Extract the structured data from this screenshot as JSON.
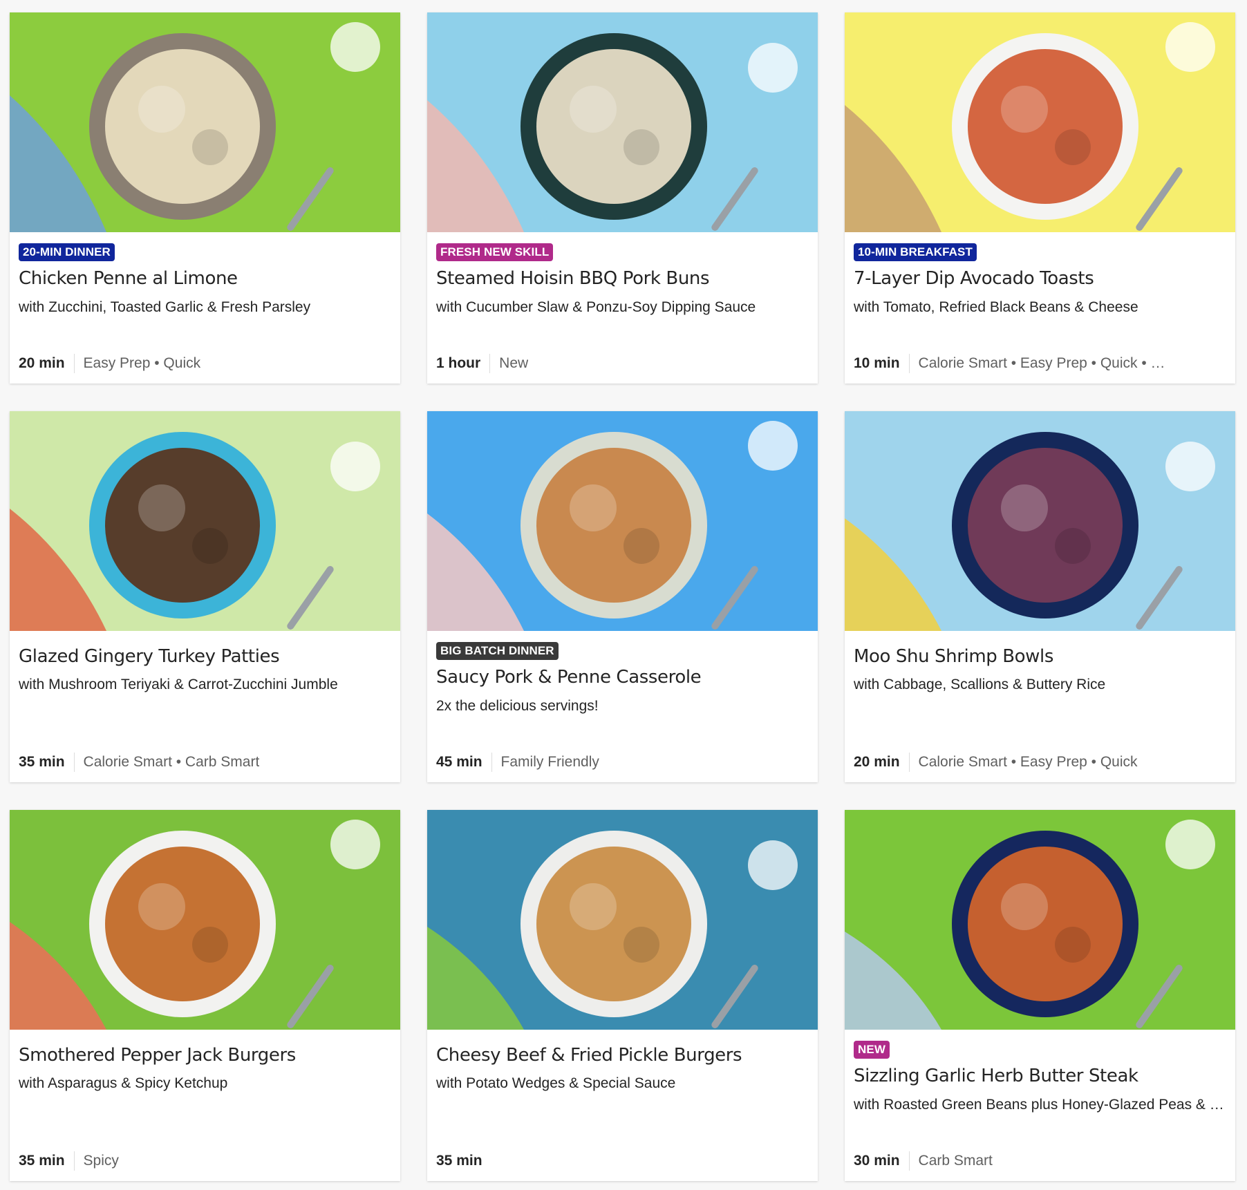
{
  "colors": {
    "badge_blue": "#10269c",
    "badge_magenta": "#b02a8a",
    "badge_dark": "#3a3a3a"
  },
  "recipes": [
    {
      "badge": "20-MIN DINNER",
      "badge_color": "#10269c",
      "title": "Chicken Penne al Limone",
      "subtitle": "with Zucchini, Toasted Garlic & Fresh Parsley",
      "time": "20 min",
      "tags": "Easy Prep • Quick",
      "bg": "#8ccc3e",
      "plate": "#8a7f72",
      "food": "#ece2c2",
      "accent": "#6ea0d8"
    },
    {
      "badge": "FRESH NEW SKILL",
      "badge_color": "#b02a8a",
      "title": "Steamed Hoisin BBQ Pork Buns",
      "subtitle": "with Cucumber Slaw & Ponzu-Soy Dipping Sauce",
      "time": "1 hour",
      "tags": "New",
      "bg": "#8fd0ea",
      "plate": "#1f3d3c",
      "food": "#efe4cc",
      "accent": "#f0b8b0"
    },
    {
      "badge": "10-MIN BREAKFAST",
      "badge_color": "#10269c",
      "title": "7-Layer Dip Avocado Toasts",
      "subtitle": "with Tomato, Refried Black Beans & Cheese",
      "time": "10 min",
      "tags": "Calorie Smart • Easy Prep • Quick • …",
      "bg": "#f6ee6e",
      "plate": "#f4f4f2",
      "food": "#d0562e",
      "accent": "#c8a070"
    },
    {
      "badge": "",
      "badge_color": "",
      "title": "Glazed Gingery Turkey Patties",
      "subtitle": "with Mushroom Teriyaki & Carrot-Zucchini Jumble",
      "time": "35 min",
      "tags": "Calorie Smart • Carb Smart",
      "bg": "#cfe8a8",
      "plate": "#3cb4d8",
      "food": "#5a3018",
      "accent": "#e06848"
    },
    {
      "badge": "BIG BATCH DINNER",
      "badge_color": "#3a3a3a",
      "title": "Saucy Pork & Penne Casserole",
      "subtitle": "2x the delicious servings!",
      "time": "45 min",
      "tags": "Family Friendly",
      "bg": "#4aa8ec",
      "plate": "#d8dcd0",
      "food": "#c88040",
      "accent": "#f4c8c4"
    },
    {
      "badge": "",
      "badge_color": "",
      "title": "Moo Shu Shrimp Bowls",
      "subtitle": "with Cabbage, Scallions & Buttery Rice",
      "time": "20 min",
      "tags": "Calorie Smart • Easy Prep • Quick",
      "bg": "#9fd4ec",
      "plate": "#14285a",
      "food": "#7a3c58",
      "accent": "#f2d040"
    },
    {
      "badge": "",
      "badge_color": "",
      "title": "Smothered Pepper Jack Burgers",
      "subtitle": "with Asparagus & Spicy Ketchup",
      "time": "35 min",
      "tags": "Spicy",
      "bg": "#7cc03c",
      "plate": "#f2f2f0",
      "food": "#c0641e",
      "accent": "#ec6e58"
    },
    {
      "badge": "",
      "badge_color": "",
      "title": "Cheesy Beef & Fried Pickle Burgers",
      "subtitle": "with Potato Wedges & Special Sauce",
      "time": "35 min",
      "tags": "",
      "bg": "#3a8cb0",
      "plate": "#eeeeec",
      "food": "#c88a40",
      "accent": "#86c840"
    },
    {
      "badge": "NEW",
      "badge_color": "#b02a8a",
      "title": "Sizzling Garlic Herb Butter Steak",
      "subtitle": "with Roasted Green Beans plus Honey-Glazed Peas & Carrots",
      "time": "30 min",
      "tags": "Carb Smart",
      "bg": "#7cc63a",
      "plate": "#15275e",
      "food": "#d8672a",
      "accent": "#b4c8e8"
    }
  ]
}
